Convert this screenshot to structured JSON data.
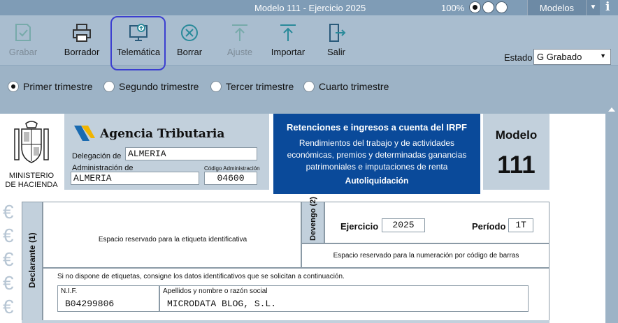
{
  "window": {
    "title": "Modelo 111 - Ejercicio 2025",
    "zoom": "100%",
    "modelos_label": "Modelos"
  },
  "toolbar": {
    "grabar": "Grabar",
    "borrador": "Borrador",
    "telematica": "Telemática",
    "borrar": "Borrar",
    "ajuste": "Ajuste",
    "importar": "Importar",
    "salir": "Salir",
    "estado_label": "Estado",
    "estado_value": "G Grabado"
  },
  "periods": [
    {
      "label": "Primer trimestre",
      "checked": true
    },
    {
      "label": "Segundo  trimestre",
      "checked": false
    },
    {
      "label": "Tercer trimestre",
      "checked": false
    },
    {
      "label": "Cuarto trimestre",
      "checked": false
    }
  ],
  "header": {
    "ministerio_line1": "MINISTERIO",
    "ministerio_line2": "DE HACIENDA",
    "agencia": "Agencia Tributaria",
    "delegacion_label": "Delegación de",
    "delegacion_value": "ALMERIA",
    "administracion_label": "Administración de",
    "administracion_value": "ALMERIA",
    "codigo_label": "Código Administración",
    "codigo_value": "04600",
    "irpf_title": "Retenciones e ingresos a cuenta del IRPF",
    "irpf_desc": "Rendimientos del trabajo y de actividades económicas, premios  y determinadas ganancias patrimoniales e imputaciones de renta",
    "irpf_sub": "Autoliquidación",
    "modelo_label": "Modelo",
    "modelo_number": "111"
  },
  "declarante": {
    "side_label": "Declarante (1)",
    "etiqueta_msg": "Espacio reservado para la etiqueta identificativa",
    "no_etiqueta_msg": "Si no dispone de etiquetas, consigne los datos identificativos que se solicitan a continuación.",
    "nif_label": "N.I.F.",
    "nif_value": "B04299806",
    "nombre_label": "Apellidos y nombre o razón social",
    "nombre_value": "MICRODATA BLOG, S.L."
  },
  "devengo": {
    "side_label": "Devengo (2)",
    "ejercicio_label": "Ejercicio",
    "ejercicio_value": "2025",
    "periodo_label": "Período",
    "periodo_value": "1T",
    "barcode_msg": "Espacio reservado para la numeración por código de barras"
  },
  "colors": {
    "accent_blue": "#0a4a9a",
    "highlight": "#3c3fd0"
  }
}
